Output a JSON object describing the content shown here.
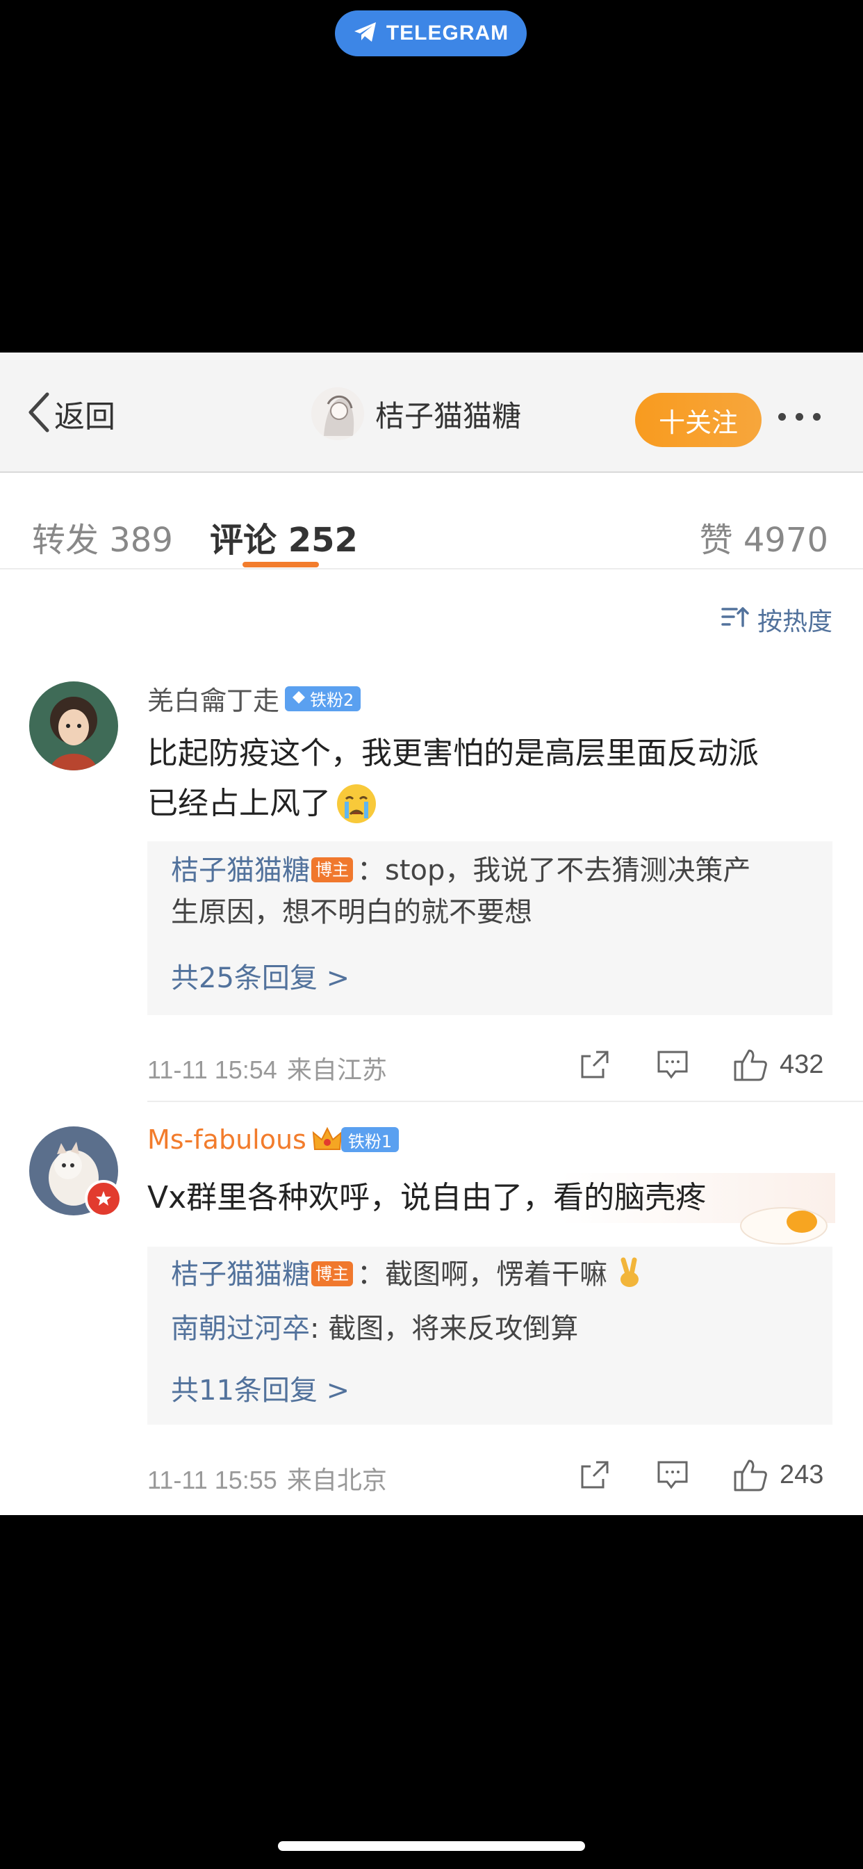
{
  "overlay": {
    "telegram_label": "TELEGRAM",
    "accent": "#3d86e6"
  },
  "navbar": {
    "back_label": "返回",
    "user_name": "桔子猫猫糖",
    "follow_label": "十关注",
    "more_icon": "more-dots-icon"
  },
  "tabs": [
    {
      "label": "转发 389"
    },
    {
      "label": "评论 252",
      "active": true
    },
    {
      "label": "赞 4970"
    }
  ],
  "sort": {
    "label": "按热度",
    "icon": "sort-icon"
  },
  "colors": {
    "accent_orange": "#f27c2c",
    "link_blue": "#52729c",
    "fan_badge": "#5aa0f0"
  },
  "comments": [
    {
      "user": "羌白龠丁走",
      "fan_badge": "铁粉2",
      "text_line1": "比起防疫这个，我更害怕的是高层里面反动派",
      "text_line2": "已经占上风了",
      "emoji_icon": "crying-face-icon",
      "replies": [
        {
          "author": "桔子猫猫糖",
          "host_tag": "博主",
          "text_line1": "：stop，我说了不去猜测决策产",
          "text_line2": "生原因，想不明白的就不要想"
        }
      ],
      "more_replies": "共25条回复 >",
      "time": "11-11 15:54",
      "source": "来自江苏",
      "likes": "432"
    },
    {
      "user": "Ms-fabulous",
      "fan_badge": "铁粉1",
      "text": "Vx群里各种欢呼，说自由了，看的脑壳疼",
      "replies": [
        {
          "author": "桔子猫猫糖",
          "host_tag": "博主",
          "text": "：截图啊，愣着干嘛"
        },
        {
          "author": "南朝过河卒",
          "text": ": 截图，将来反攻倒算"
        }
      ],
      "more_replies": "共11条回复 >",
      "time": "11-11 15:55",
      "source": "来自北京",
      "likes": "243"
    }
  ]
}
